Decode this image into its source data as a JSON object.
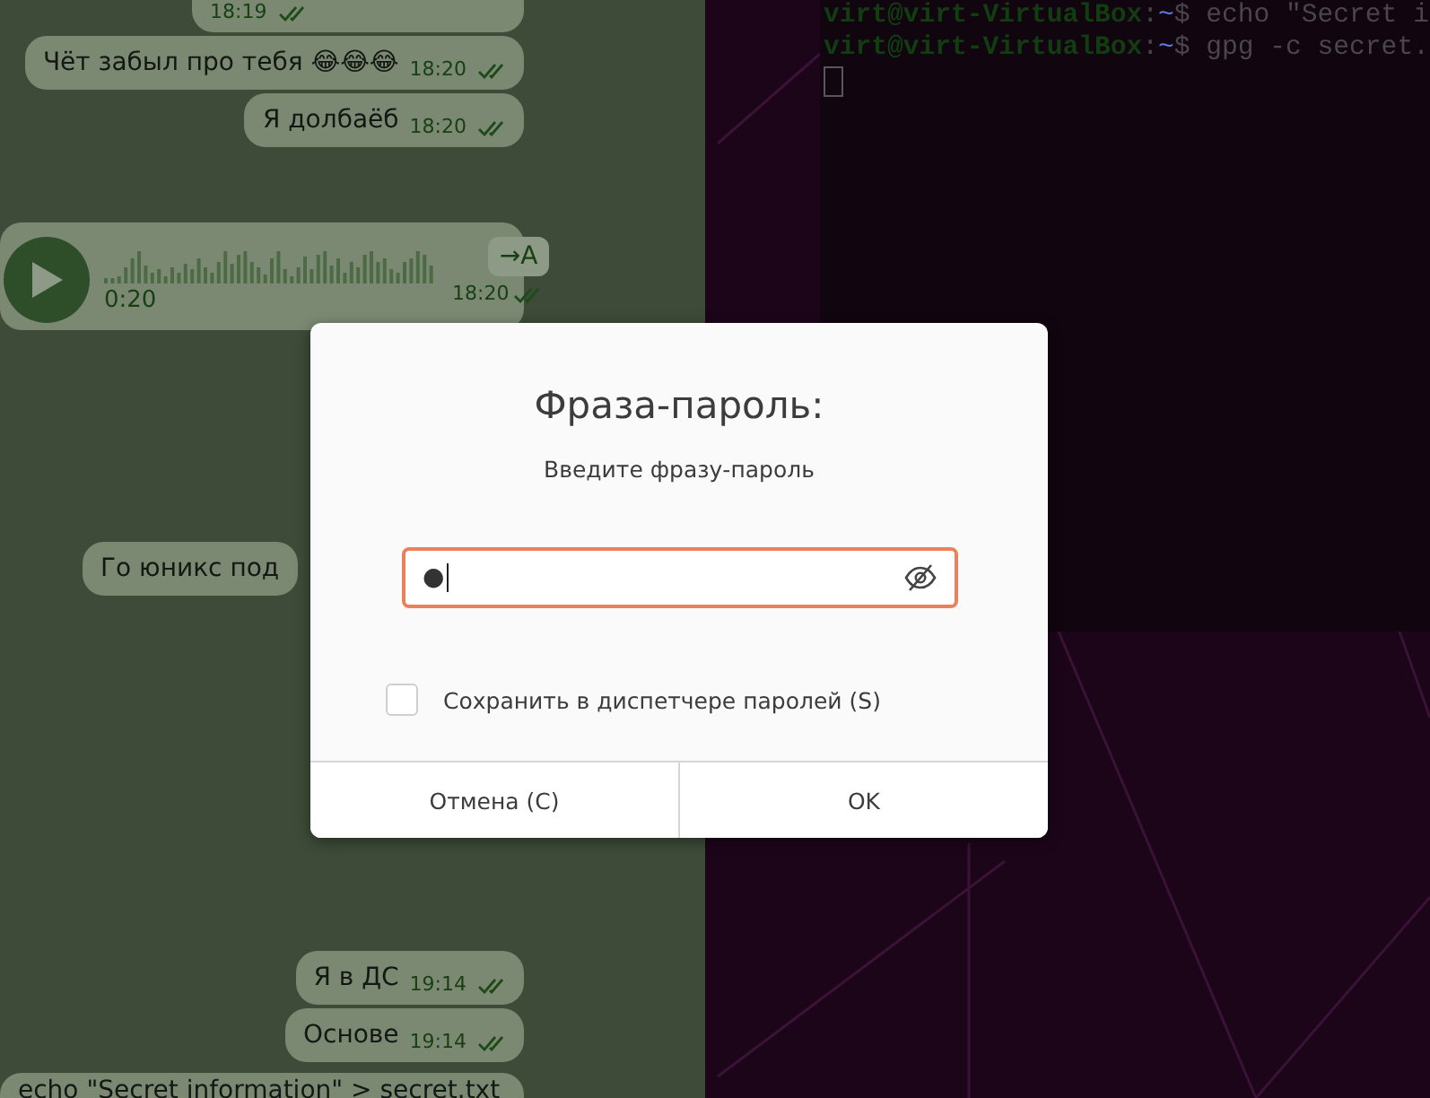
{
  "chat": {
    "messages": [
      {
        "kind": "text",
        "time": "18:19",
        "read": true
      },
      {
        "kind": "text",
        "text": "Чёт забыл про тебя 😂😂😂",
        "time": "18:20",
        "read": true
      },
      {
        "kind": "text",
        "text": "Я долбаёб",
        "time": "18:20",
        "read": true
      },
      {
        "kind": "voice",
        "duration": "0:20",
        "transcribe": "→A",
        "time": "18:20",
        "read": true
      },
      {
        "kind": "text",
        "text": "Го юникс под"
      },
      {
        "kind": "text",
        "text": "Я в ДС",
        "time": "19:14",
        "read": true
      },
      {
        "kind": "text",
        "text": "Основе",
        "time": "19:14",
        "read": true
      },
      {
        "kind": "text",
        "text": "echo \"Secret information\" > secret.txt"
      }
    ]
  },
  "terminal": {
    "lines": [
      {
        "user": "virt@virt-VirtualBox",
        "separator": ":",
        "path": "~",
        "sigil": "$",
        "command": "echo \"Secret i"
      },
      {
        "user": "virt@virt-VirtualBox",
        "separator": ":",
        "path": "~",
        "sigil": "$",
        "command": "gpg -c secret."
      }
    ]
  },
  "dialog": {
    "title": "Фраза-пароль:",
    "message": "Введите фразу-пароль",
    "field": {
      "value": "●",
      "focused": true
    },
    "checkbox": {
      "label": "Сохранить в диспетчере паролей (S)",
      "checked": false
    },
    "buttons": [
      "Отмена (C)",
      "OK"
    ]
  }
}
